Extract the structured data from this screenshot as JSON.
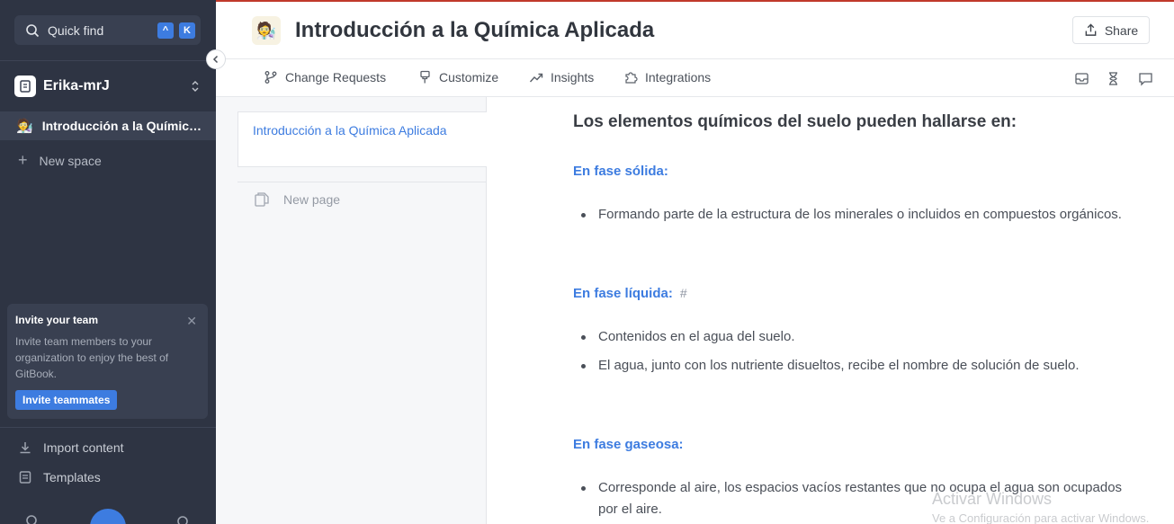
{
  "sidebar": {
    "quickfind_label": "Quick find",
    "shortcut_keys": [
      "^",
      "K"
    ],
    "org_name": "Erika-mrJ",
    "spaces": [
      {
        "emoji": "🧑‍🔬",
        "label": "Introducción a la Química Aplicada"
      }
    ],
    "new_space_label": "New space",
    "invite_card": {
      "title": "Invite your team",
      "text": "Invite team members to your organization to enjoy the best of GitBook.",
      "button_label": "Invite teammates"
    },
    "bottom_links": {
      "import": "Import content",
      "templates": "Templates"
    }
  },
  "header": {
    "emoji": "🧑‍🔬",
    "title": "Introducción a la Química Aplicada",
    "share_label": "Share"
  },
  "tabs": {
    "change_requests": "Change Requests",
    "customize": "Customize",
    "insights": "Insights",
    "integrations": "Integrations"
  },
  "pages_pane": {
    "current_page": "Introducción a la Química Aplicada",
    "new_page_label": "New page"
  },
  "content": {
    "heading": "Los elementos químicos del suelo pueden hallarse en:",
    "sections": [
      {
        "title": "En fase sólida:",
        "items": [
          "Formando parte de la estructura de los minerales o incluidos en compuestos orgánicos."
        ]
      },
      {
        "title": "En fase líquida:",
        "anchor": "#",
        "items": [
          "Contenidos en el agua del suelo.",
          "El agua, junto con los nutriente disueltos, recibe el nombre de solución de suelo."
        ]
      },
      {
        "title": "En fase gaseosa:",
        "items": [
          "Corresponde al aire, los espacios vacíos restantes que no ocupa el agua son ocupados por el aire."
        ]
      }
    ]
  },
  "watermark": {
    "line1": "Activar Windows",
    "line2": "Ve a Configuración para activar Windows."
  },
  "colors": {
    "sidebar_bg": "#2e3443",
    "accent": "#3d7ce0",
    "top_line": "#c0392b"
  }
}
